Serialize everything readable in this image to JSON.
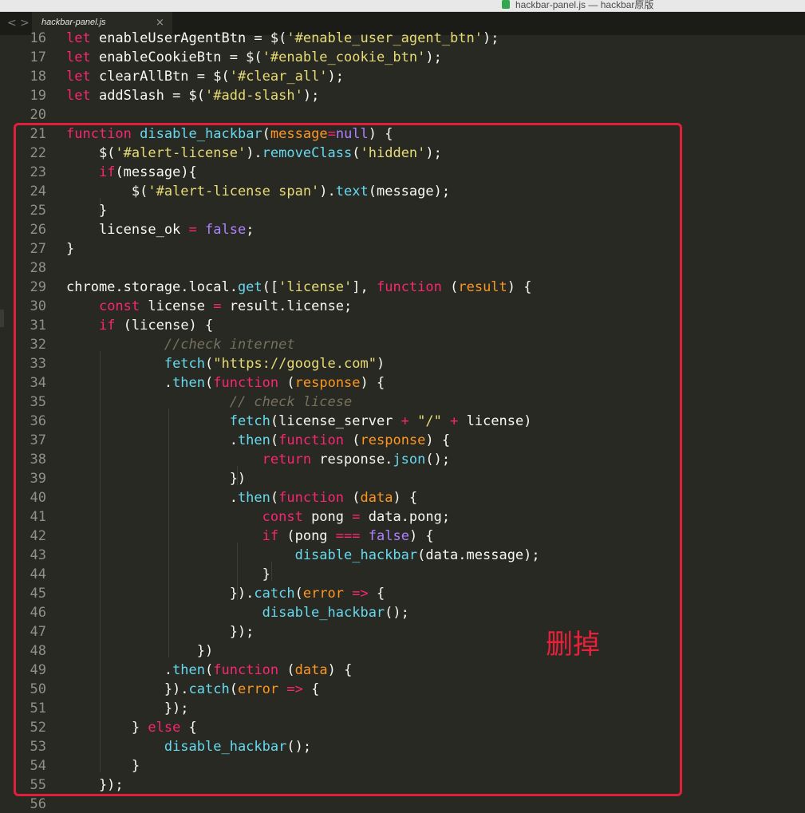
{
  "window": {
    "title": "hackbar-panel.js — hackbar原版"
  },
  "tab": {
    "label": "hackbar-panel.js",
    "close": "×"
  },
  "nav": {
    "back": "<",
    "forward": ">"
  },
  "annotation": "删掉",
  "colors": {
    "background": "#282923",
    "text": "#f8f8f2",
    "keyword": "#f92672",
    "function": "#66d9ef",
    "string": "#e6db74",
    "constant": "#ae81ff",
    "param": "#fd971f",
    "comment": "#75715e",
    "box": "#e0203a"
  },
  "code": {
    "lines": [
      {
        "n": "16",
        "t": [
          [
            "k",
            "let"
          ],
          [
            "d",
            " enableUserAgentBtn = $("
          ],
          [
            "s",
            "'#enable_user_agent_btn'"
          ],
          [
            "d",
            ");"
          ]
        ]
      },
      {
        "n": "17",
        "t": [
          [
            "k",
            "let"
          ],
          [
            "d",
            " enableCookieBtn = $("
          ],
          [
            "s",
            "'#enable_cookie_btn'"
          ],
          [
            "d",
            ");"
          ]
        ]
      },
      {
        "n": "18",
        "t": [
          [
            "k",
            "let"
          ],
          [
            "d",
            " clearAllBtn = $("
          ],
          [
            "s",
            "'#clear_all'"
          ],
          [
            "d",
            ");"
          ]
        ]
      },
      {
        "n": "19",
        "t": [
          [
            "k",
            "let"
          ],
          [
            "d",
            " addSlash = $("
          ],
          [
            "s",
            "'#add-slash'"
          ],
          [
            "d",
            ");"
          ]
        ]
      },
      {
        "n": "20",
        "t": []
      },
      {
        "n": "21",
        "t": [
          [
            "k",
            "function"
          ],
          [
            "d",
            " "
          ],
          [
            "f",
            "disable_hackbar"
          ],
          [
            "d",
            "("
          ],
          [
            "p",
            "message"
          ],
          [
            "k",
            "="
          ],
          [
            "n",
            "null"
          ],
          [
            "d",
            ") {"
          ]
        ]
      },
      {
        "n": "22",
        "t": [
          [
            "d",
            "    $("
          ],
          [
            "s",
            "'#alert-license'"
          ],
          [
            "d",
            ")."
          ],
          [
            "f",
            "removeClass"
          ],
          [
            "d",
            "("
          ],
          [
            "s",
            "'hidden'"
          ],
          [
            "d",
            ");"
          ]
        ]
      },
      {
        "n": "23",
        "t": [
          [
            "d",
            "    "
          ],
          [
            "k",
            "if"
          ],
          [
            "d",
            "(message){"
          ]
        ]
      },
      {
        "n": "24",
        "t": [
          [
            "d",
            "        $("
          ],
          [
            "s",
            "'#alert-license span'"
          ],
          [
            "d",
            ")."
          ],
          [
            "f",
            "text"
          ],
          [
            "d",
            "(message);"
          ]
        ]
      },
      {
        "n": "25",
        "t": [
          [
            "d",
            "    }"
          ]
        ]
      },
      {
        "n": "26",
        "t": [
          [
            "d",
            "    license_ok "
          ],
          [
            "k",
            "="
          ],
          [
            "d",
            " "
          ],
          [
            "n",
            "false"
          ],
          [
            "d",
            ";"
          ]
        ]
      },
      {
        "n": "27",
        "t": [
          [
            "d",
            "}"
          ]
        ]
      },
      {
        "n": "28",
        "t": []
      },
      {
        "n": "29",
        "t": [
          [
            "d",
            "chrome.storage.local."
          ],
          [
            "f",
            "get"
          ],
          [
            "d",
            "(["
          ],
          [
            "s",
            "'license'"
          ],
          [
            "d",
            "], "
          ],
          [
            "k",
            "function"
          ],
          [
            "d",
            " ("
          ],
          [
            "p",
            "result"
          ],
          [
            "d",
            ") {"
          ]
        ]
      },
      {
        "n": "30",
        "t": [
          [
            "d",
            "    "
          ],
          [
            "k",
            "const"
          ],
          [
            "d",
            " license "
          ],
          [
            "k",
            "="
          ],
          [
            "d",
            " result.license;"
          ]
        ]
      },
      {
        "n": "31",
        "t": [
          [
            "d",
            "    "
          ],
          [
            "k",
            "if"
          ],
          [
            "d",
            " (license) {"
          ]
        ]
      },
      {
        "n": "32",
        "t": [
          [
            "d",
            "            "
          ],
          [
            "c",
            "//check internet"
          ]
        ]
      },
      {
        "n": "33",
        "t": [
          [
            "d",
            "            "
          ],
          [
            "f",
            "fetch"
          ],
          [
            "d",
            "("
          ],
          [
            "s",
            "\"https://google.com\""
          ],
          [
            "d",
            ")"
          ]
        ]
      },
      {
        "n": "34",
        "t": [
          [
            "d",
            "            ."
          ],
          [
            "f",
            "then"
          ],
          [
            "d",
            "("
          ],
          [
            "k",
            "function"
          ],
          [
            "d",
            " ("
          ],
          [
            "p",
            "response"
          ],
          [
            "d",
            ") {"
          ]
        ]
      },
      {
        "n": "35",
        "t": [
          [
            "d",
            "                    "
          ],
          [
            "c",
            "// check licese"
          ]
        ]
      },
      {
        "n": "36",
        "t": [
          [
            "d",
            "                    "
          ],
          [
            "f",
            "fetch"
          ],
          [
            "d",
            "(license_server "
          ],
          [
            "k",
            "+"
          ],
          [
            "d",
            " "
          ],
          [
            "s",
            "\"/\""
          ],
          [
            "d",
            " "
          ],
          [
            "k",
            "+"
          ],
          [
            "d",
            " license)"
          ]
        ]
      },
      {
        "n": "37",
        "t": [
          [
            "d",
            "                    ."
          ],
          [
            "f",
            "then"
          ],
          [
            "d",
            "("
          ],
          [
            "k",
            "function"
          ],
          [
            "d",
            " ("
          ],
          [
            "p",
            "response"
          ],
          [
            "d",
            ") {"
          ]
        ]
      },
      {
        "n": "38",
        "t": [
          [
            "d",
            "                        "
          ],
          [
            "k",
            "return"
          ],
          [
            "d",
            " response."
          ],
          [
            "f",
            "json"
          ],
          [
            "d",
            "();"
          ]
        ]
      },
      {
        "n": "39",
        "t": [
          [
            "d",
            "                    })"
          ]
        ]
      },
      {
        "n": "40",
        "t": [
          [
            "d",
            "                    ."
          ],
          [
            "f",
            "then"
          ],
          [
            "d",
            "("
          ],
          [
            "k",
            "function"
          ],
          [
            "d",
            " ("
          ],
          [
            "p",
            "data"
          ],
          [
            "d",
            ") {"
          ]
        ]
      },
      {
        "n": "41",
        "t": [
          [
            "d",
            "                        "
          ],
          [
            "k",
            "const"
          ],
          [
            "d",
            " pong "
          ],
          [
            "k",
            "="
          ],
          [
            "d",
            " data.pong;"
          ]
        ]
      },
      {
        "n": "42",
        "t": [
          [
            "d",
            "                        "
          ],
          [
            "k",
            "if"
          ],
          [
            "d",
            " (pong "
          ],
          [
            "k",
            "==="
          ],
          [
            "d",
            " "
          ],
          [
            "n",
            "false"
          ],
          [
            "d",
            ") {"
          ]
        ]
      },
      {
        "n": "43",
        "t": [
          [
            "d",
            "                            "
          ],
          [
            "f",
            "disable_hackbar"
          ],
          [
            "d",
            "(data.message);"
          ]
        ]
      },
      {
        "n": "44",
        "t": [
          [
            "d",
            "                        }"
          ]
        ]
      },
      {
        "n": "45",
        "t": [
          [
            "d",
            "                    })."
          ],
          [
            "f",
            "catch"
          ],
          [
            "d",
            "("
          ],
          [
            "p",
            "error"
          ],
          [
            "d",
            " "
          ],
          [
            "k",
            "=>"
          ],
          [
            "d",
            " {"
          ]
        ]
      },
      {
        "n": "46",
        "t": [
          [
            "d",
            "                        "
          ],
          [
            "f",
            "disable_hackbar"
          ],
          [
            "d",
            "();"
          ]
        ]
      },
      {
        "n": "47",
        "t": [
          [
            "d",
            "                    });"
          ]
        ]
      },
      {
        "n": "48",
        "t": [
          [
            "d",
            "                })"
          ]
        ]
      },
      {
        "n": "49",
        "t": [
          [
            "d",
            "            ."
          ],
          [
            "f",
            "then"
          ],
          [
            "d",
            "("
          ],
          [
            "k",
            "function"
          ],
          [
            "d",
            " ("
          ],
          [
            "p",
            "data"
          ],
          [
            "d",
            ") {"
          ]
        ]
      },
      {
        "n": "50",
        "t": [
          [
            "d",
            "            })."
          ],
          [
            "f",
            "catch"
          ],
          [
            "d",
            "("
          ],
          [
            "p",
            "error"
          ],
          [
            "d",
            " "
          ],
          [
            "k",
            "=>"
          ],
          [
            "d",
            " {"
          ]
        ]
      },
      {
        "n": "51",
        "t": [
          [
            "d",
            "            });"
          ]
        ]
      },
      {
        "n": "52",
        "t": [
          [
            "d",
            "        } "
          ],
          [
            "k",
            "else"
          ],
          [
            "d",
            " {"
          ]
        ]
      },
      {
        "n": "53",
        "t": [
          [
            "d",
            "            "
          ],
          [
            "f",
            "disable_hackbar"
          ],
          [
            "d",
            "();"
          ]
        ]
      },
      {
        "n": "54",
        "t": [
          [
            "d",
            "        }"
          ]
        ]
      },
      {
        "n": "55",
        "t": [
          [
            "d",
            "    });"
          ]
        ]
      },
      {
        "n": "56",
        "t": []
      }
    ]
  }
}
